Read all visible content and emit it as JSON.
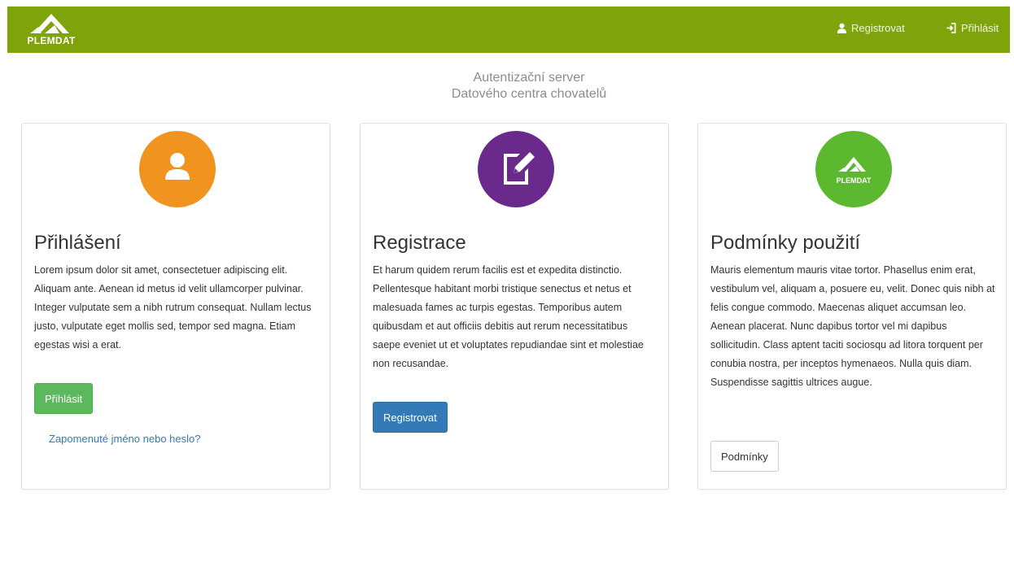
{
  "brand": {
    "name": "PLEMDAT"
  },
  "nav": {
    "register_label": "Registrovat",
    "login_label": "Přihlásit"
  },
  "header": {
    "line1": "Autentizační server",
    "line2": "Datového centra chovatelů"
  },
  "cards": [
    {
      "title": "Přihlášení",
      "text": "Lorem ipsum dolor sit amet, consectetuer adipiscing elit. Aliquam ante. Aenean id metus id velit ullamcorper pulvinar. Integer vulputate sem a nibh rutrum consequat. Nullam lectus justo, vulputate eget mollis sed, tempor sed magna. Etiam egestas wisi a erat.",
      "button_label": "Přihlásit",
      "link_label": "Zapomenuté jméno nebo heslo?",
      "icon": "user-icon",
      "icon_color": "#f0931f"
    },
    {
      "title": "Registrace",
      "text": "Et harum quidem rerum facilis est et expedita distinctio. Pellentesque habitant morbi tristique senectus et netus et malesuada fames ac turpis egestas. Temporibus autem quibusdam et aut officiis debitis aut rerum necessitatibus saepe eveniet ut et voluptates repudiandae sint et molestiae non recusandae.",
      "button_label": "Registrovat",
      "icon": "edit-icon",
      "icon_color": "#6a2a8c"
    },
    {
      "title": "Podmínky použití",
      "text": "Mauris elementum mauris vitae tortor. Phasellus enim erat, vestibulum vel, aliquam a, posuere eu, velit. Donec quis nibh at felis congue commodo. Maecenas aliquet accumsan leo. Aenean placerat. Nunc dapibus tortor vel mi dapibus sollicitudin. Class aptent taciti sociosqu ad litora torquent per conubia nostra, per inceptos hymenaeos. Nulla quis diam. Suspendisse sagittis ultrices augue.",
      "button_label": "Podmínky",
      "icon": "plemdat-logo-icon",
      "icon_color": "#5cb82e",
      "icon_text": "PLEMDAT"
    }
  ],
  "colors": {
    "navbar": "#7ea30b",
    "success": "#5cb85c",
    "primary": "#337ab7"
  }
}
